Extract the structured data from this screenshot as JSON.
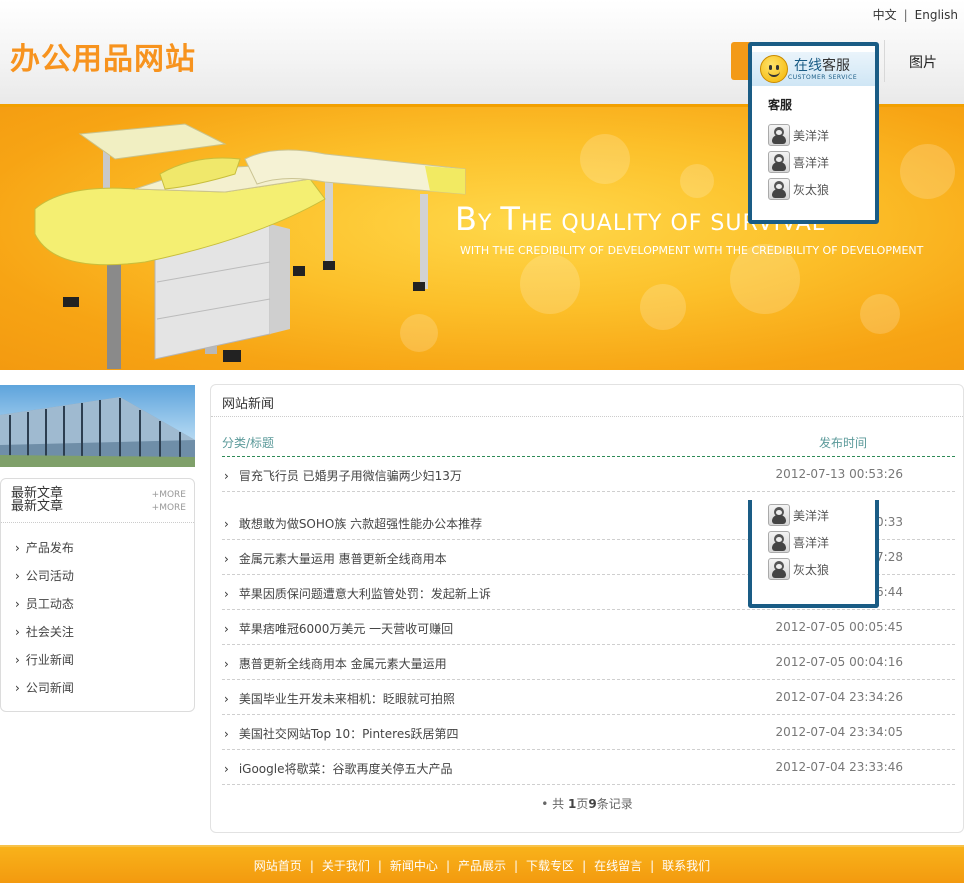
{
  "header": {
    "lang_cn": "中文",
    "lang_sep": "|",
    "lang_en": "English",
    "logo": "办公用品网站",
    "nav_picture": "图片"
  },
  "banner": {
    "tagline_part1": "B",
    "tagline_part2": "Y ",
    "tagline_part3": "T",
    "tagline_part4": "HE QUALITY OF SURVIVAL",
    "subline": "WITH THE CREDIBILITY OF DEVELOPMENT WITH THE CREDIBILITY OF DEVELOPMENT"
  },
  "sidebar": {
    "title_line1": "最新文章",
    "title_line2": "最新文章",
    "more_line1": "+MORE",
    "more_line2": "+MORE",
    "items": [
      {
        "label": "产品发布"
      },
      {
        "label": "公司活动"
      },
      {
        "label": "员工动态"
      },
      {
        "label": "社会关注"
      },
      {
        "label": "行业新闻"
      },
      {
        "label": "公司新闻"
      }
    ]
  },
  "news": {
    "title": "网站新闻",
    "col_title": "分类/标题",
    "col_date": "发布时间",
    "rows": [
      {
        "title": "冒充飞行员 已婚男子用微信骗两少妇13万",
        "date": "2012-07-13 00:53:26"
      },
      {
        "title": "敢想敢为做SOHO族 六款超强性能办公本推荐",
        "date": "2012-07-12 20:00:33"
      },
      {
        "title": "金属元素大量运用 惠普更新全线商用本",
        "date": "2012-07-07 12:27:28"
      },
      {
        "title": "苹果因质保问题遭意大利监管处罚：发起新上诉",
        "date": "2012-07-05 00:06:44"
      },
      {
        "title": "苹果痞唯冠6000万美元 一天营收可赚回",
        "date": "2012-07-05 00:05:45"
      },
      {
        "title": "惠普更新全线商用本 金属元素大量运用",
        "date": "2012-07-05 00:04:16"
      },
      {
        "title": "美国毕业生开发未来相机：眨眼就可拍照",
        "date": "2012-07-04 23:34:26"
      },
      {
        "title": "美国社交网站Top 10：Pinteres跃居第四",
        "date": "2012-07-04 23:34:05"
      },
      {
        "title": "iGoogle将歇菜：谷歌再度关停五大产品",
        "date": "2012-07-04 23:33:46"
      }
    ],
    "pager_prefix": "• 共 ",
    "pager_pages": "1",
    "pager_mid": "页",
    "pager_count": "9",
    "pager_suffix": "条记录"
  },
  "service": {
    "title_online": "在线",
    "title_service": "客服",
    "subtitle": "CUSTOMER SERVICE",
    "group": "客服",
    "agents": [
      {
        "name": "美洋洋"
      },
      {
        "name": "喜洋洋"
      },
      {
        "name": "灰太狼"
      }
    ]
  },
  "footer": {
    "links": [
      {
        "label": "网站首页"
      },
      {
        "label": "关于我们"
      },
      {
        "label": "新闻中心"
      },
      {
        "label": "产品展示"
      },
      {
        "label": "下载专区"
      },
      {
        "label": "在线留言"
      },
      {
        "label": "联系我们"
      }
    ],
    "separator": "|"
  },
  "colors": {
    "accent_orange": "#f7931e",
    "service_blue": "#1a5c85",
    "header_green": "#5b9a9a"
  }
}
